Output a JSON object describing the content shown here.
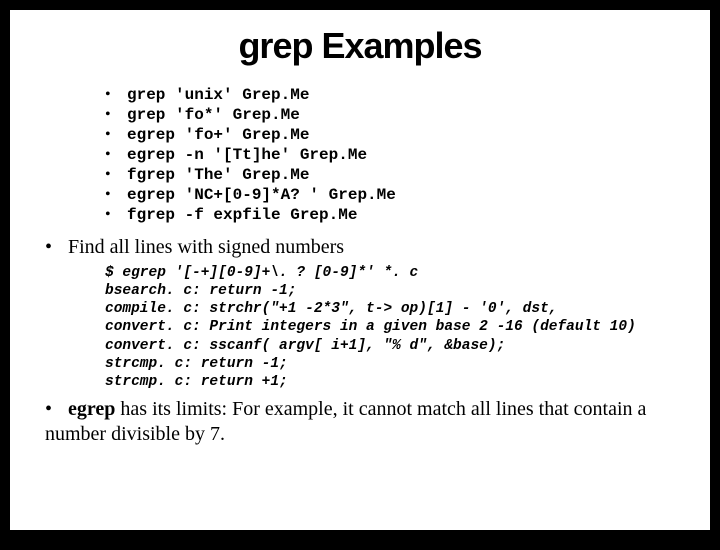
{
  "title": "grep Examples",
  "examples": [
    "grep 'unix' Grep.Me",
    "grep 'fo*' Grep.Me",
    "egrep 'fo+' Grep.Me",
    "egrep -n '[Tt]he' Grep.Me",
    "fgrep 'The' Grep.Me",
    "egrep 'NC+[0-9]*A? ' Grep.Me",
    "fgrep -f expfile Grep.Me"
  ],
  "bullet1": "Find all lines with signed numbers",
  "codeblock": "$ egrep '[-+][0-9]+\\. ? [0-9]*' *. c\nbsearch. c: return -1;\ncompile. c: strchr(\"+1 -2*3\", t-> op)[1] - '0', dst,\nconvert. c: Print integers in a given base 2 -16 (default 10)\nconvert. c: sscanf( argv[ i+1], \"% d\", &base);\nstrcmp. c: return -1;\nstrcmp. c: return +1;",
  "bullet2_bold": "egrep",
  "bullet2_rest": " has its limits: For example, it cannot match all lines that contain a number divisible by 7."
}
